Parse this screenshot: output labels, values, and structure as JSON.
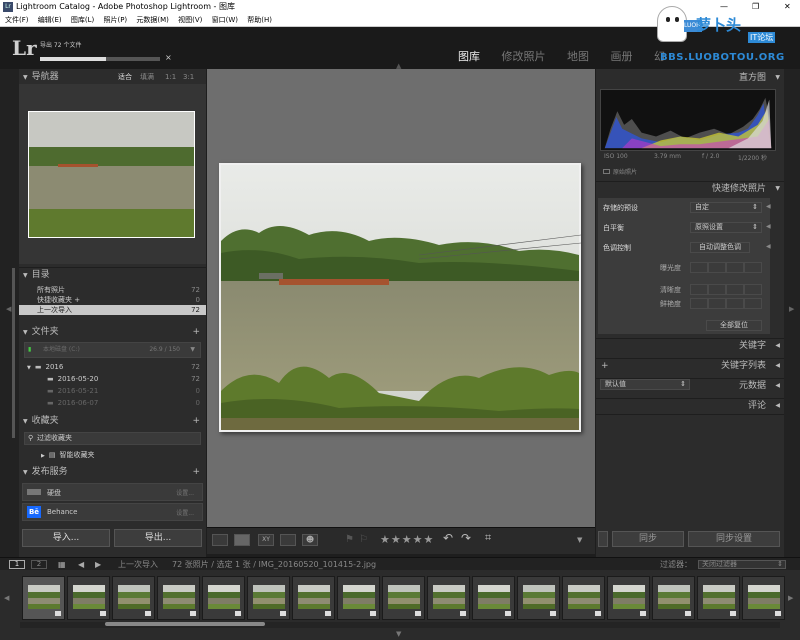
{
  "window": {
    "title": "Lightroom Catalog - Adobe Photoshop Lightroom - 图库",
    "controls": [
      "—",
      "❐",
      "✕"
    ]
  },
  "menu": [
    "文件(F)",
    "编辑(E)",
    "图库(L)",
    "照片(P)",
    "元数据(M)",
    "视图(V)",
    "窗口(W)",
    "帮助(H)"
  ],
  "header": {
    "logo": "Lr",
    "import_status": "导出 72 个文件",
    "progress": 0.55,
    "modules": [
      {
        "label": "图库",
        "active": true
      },
      {
        "label": "修改照片",
        "active": false
      },
      {
        "label": "地图",
        "active": false
      },
      {
        "label": "画册",
        "active": false
      },
      {
        "label": "幻",
        "active": false
      }
    ]
  },
  "watermark": {
    "line1": "萝卜头",
    "line2": "IT论坛",
    "line3": "BBS.LUOBOTOU.ORG",
    "badge": "LUOBO"
  },
  "navigator": {
    "title": "导航器",
    "zoom": [
      "适合",
      "填满",
      "1:1",
      "3:1"
    ]
  },
  "catalog": {
    "title": "目录",
    "items": [
      {
        "label": "所有照片",
        "count": "72"
      },
      {
        "label": "快捷收藏夹 +",
        "count": "0"
      },
      {
        "label": "上一次导入",
        "count": "72"
      }
    ]
  },
  "folders": {
    "title": "文件夹",
    "volume": {
      "label": "本地磁盘 (C:)",
      "size": "26.9 / 150"
    },
    "items": [
      {
        "label": "2016",
        "count": "72"
      },
      {
        "label": "2016-05-20",
        "count": "72"
      },
      {
        "label": "2016-05-21",
        "count": "0"
      },
      {
        "label": "2016-06-07",
        "count": "0"
      }
    ]
  },
  "collections": {
    "title": "收藏夹",
    "filter": "过滤收藏夹",
    "smart": "智能收藏夹"
  },
  "publish": {
    "title": "发布服务",
    "services": [
      {
        "label": "硬盘",
        "action": "设置..."
      },
      {
        "label": "Behance",
        "action": "设置..."
      }
    ]
  },
  "left_buttons": {
    "import": "导入...",
    "export": "导出..."
  },
  "histogram": {
    "title": "直方图",
    "iso": "ISO 100",
    "focal": "3.79 mm",
    "aperture": "f / 2.0",
    "shutter": "1/2200 秒",
    "original": "原始照片"
  },
  "quick_develop": {
    "title": "快速修改照片",
    "saved_preset": {
      "label": "存储的预设",
      "value": "自定"
    },
    "white_balance": {
      "label": "白平衡",
      "value": "原照设置"
    },
    "tone": {
      "label": "色调控制",
      "value": "自动调整色调"
    },
    "sliders": [
      "曝光度",
      "清晰度",
      "鲜艳度"
    ],
    "reset": "全部复位"
  },
  "right_sections": [
    "关键字",
    "关键字列表",
    "元数据",
    "评论"
  ],
  "metadata_preset": "默认值",
  "right_buttons": {
    "sync": "同步",
    "sync_settings": "同步设置"
  },
  "toolbar": {
    "stars": "★★★★★"
  },
  "filmbar": {
    "pages": [
      "1",
      "2"
    ],
    "source": "上一次导入",
    "info": "72 张照片 / 选定 1 张 / IMG_20160520_101415-2.jpg",
    "filter_label": "过滤器：",
    "filter_value": "关闭过滤器"
  },
  "film_count": 17
}
